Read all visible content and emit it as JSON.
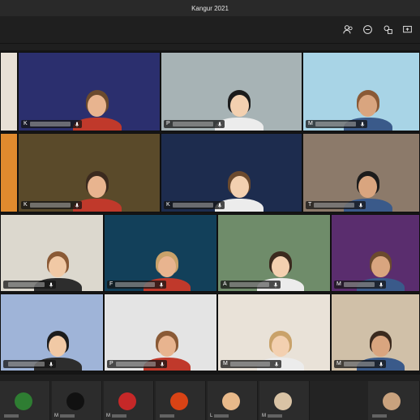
{
  "window": {
    "title": "Kangur 2021"
  },
  "toolbar": {
    "icons": [
      "participants-icon",
      "chat-icon",
      "rooms-icon",
      "share-screen-icon"
    ]
  },
  "grid": {
    "tiles": [
      {
        "initial": "",
        "bg": "#e8e0d6"
      },
      {
        "initial": "K",
        "bg": "#2b2f6e"
      },
      {
        "initial": "P",
        "bg": "#a7b3b5"
      },
      {
        "initial": "M",
        "bg": "#a8d4e6"
      },
      {
        "initial": "",
        "bg": "#e08a2e"
      },
      {
        "initial": "K",
        "bg": "#5a4a2a"
      },
      {
        "initial": "K",
        "bg": "#1d2c4e"
      },
      {
        "initial": "T",
        "bg": "#8c7a6a"
      },
      {
        "initial": "",
        "bg": "#dcd8ce"
      },
      {
        "initial": "F",
        "bg": "#12405a"
      },
      {
        "initial": "A",
        "bg": "#6f8c6a"
      },
      {
        "initial": "M",
        "bg": "#5a2d6e"
      },
      {
        "initial": "",
        "bg": "#9fb4d8"
      },
      {
        "initial": "P",
        "bg": "#e4e4e4"
      },
      {
        "initial": "M",
        "bg": "#e9e2d8"
      },
      {
        "initial": "M",
        "bg": "#d0c0a8"
      }
    ]
  },
  "strip": {
    "items": [
      {
        "initial": "",
        "avatar": "#2e7d32"
      },
      {
        "initial": "M",
        "avatar": "#111111"
      },
      {
        "initial": "M",
        "avatar": "#c62828"
      },
      {
        "initial": "",
        "avatar": "#d84315"
      },
      {
        "initial": "L",
        "avatar": "#e8b98a"
      },
      {
        "initial": "M",
        "avatar": "#d9c3a5"
      },
      {
        "initial": "",
        "avatar": "#c9a27e"
      }
    ]
  }
}
